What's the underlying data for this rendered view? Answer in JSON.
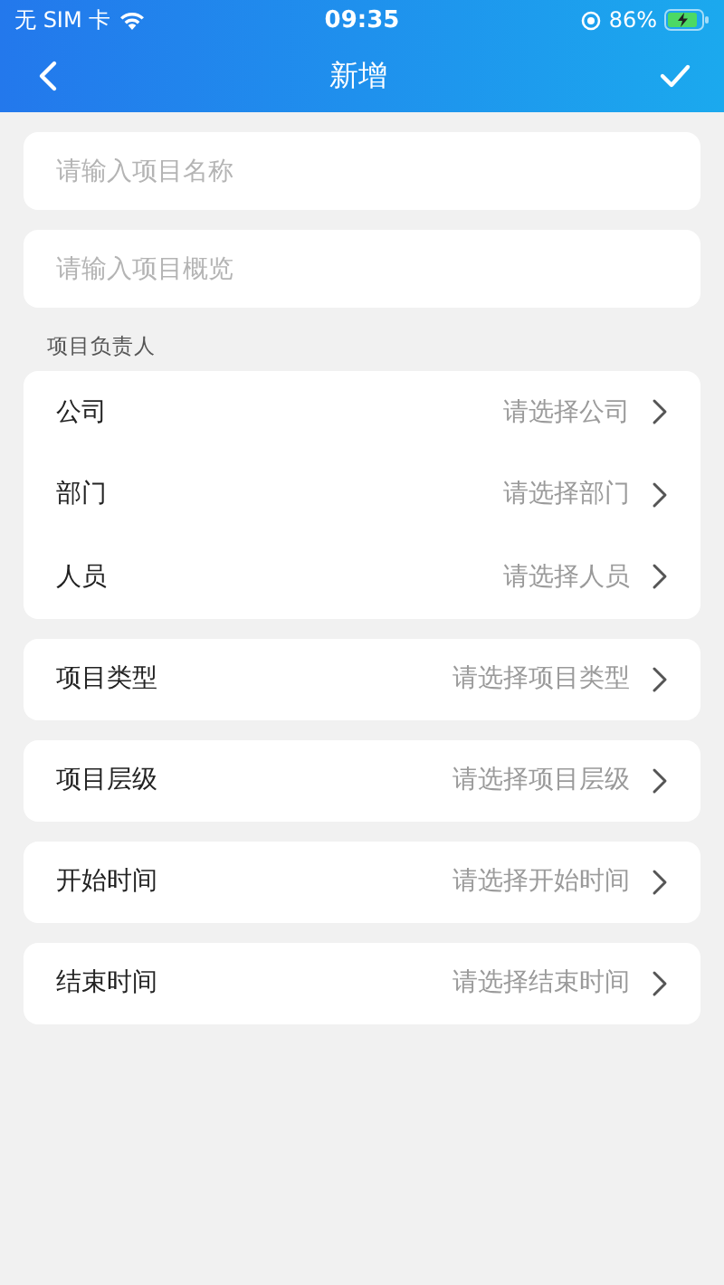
{
  "status_bar": {
    "carrier": "无 SIM 卡",
    "time": "09:35",
    "battery": "86%"
  },
  "nav": {
    "title": "新增"
  },
  "fields": [
    {
      "placeholder": "请输入项目名称"
    },
    {
      "placeholder": "请输入项目概览"
    }
  ],
  "owner_group": {
    "title": "项目负责人",
    "rows": [
      {
        "label": "公司",
        "value": "请选择公司"
      },
      {
        "label": "部门",
        "value": "请选择部门"
      },
      {
        "label": "人员",
        "value": "请选择人员"
      }
    ]
  },
  "pickers": [
    {
      "label": "项目类型",
      "value": "请选择项目类型"
    },
    {
      "label": "项目层级",
      "value": "请选择项目层级"
    },
    {
      "label": "开始时间",
      "value": "请选择开始时间"
    },
    {
      "label": "结束时间",
      "value": "请选择结束时间"
    }
  ]
}
